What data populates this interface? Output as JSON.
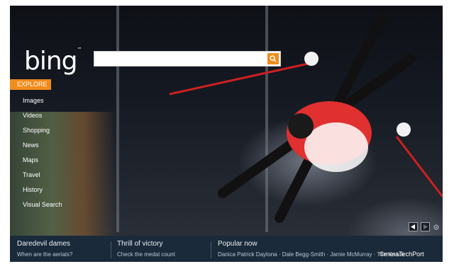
{
  "brand": {
    "logo_text": "bing",
    "accent": "#f08c1c"
  },
  "search": {
    "placeholder": "",
    "button_icon": "magnifier-icon"
  },
  "explore": {
    "label": "EXPLORE"
  },
  "nav": {
    "items": [
      {
        "label": "Images"
      },
      {
        "label": "Videos"
      },
      {
        "label": "Shopping"
      },
      {
        "label": "News"
      },
      {
        "label": "Maps"
      },
      {
        "label": "Travel"
      },
      {
        "label": "History"
      },
      {
        "label": "Visual Search"
      }
    ]
  },
  "controls": {
    "prev_icon": "arrow-left-icon",
    "next_icon": "arrow-right-icon",
    "info_icon": "info-icon"
  },
  "bottom": {
    "col1": {
      "heading": "Daredevil dames",
      "sub": "When are the aerials?"
    },
    "col2": {
      "heading": "Thrill of victory",
      "sub": "Check the medal count"
    },
    "col3": {
      "heading": "Popular now",
      "items": [
        "Danica Patrick Daytona",
        "Dale Begg-Smith",
        "Jamie McMurray",
        "The Knack"
      ]
    }
  },
  "watermark": "©meraTechPort"
}
